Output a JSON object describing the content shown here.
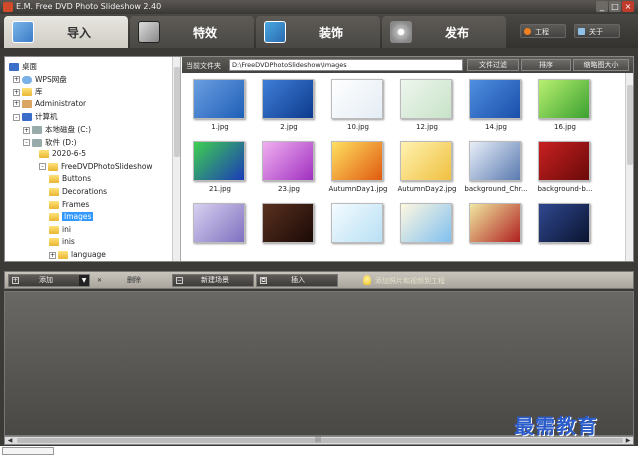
{
  "window": {
    "title": "E.M. Free DVD Photo Slideshow 2.40",
    "min": "_",
    "max": "□",
    "close": "×"
  },
  "tabs": [
    {
      "label": "导入",
      "active": true,
      "icon": "import-icon"
    },
    {
      "label": "特效",
      "active": false,
      "icon": "effects-icon"
    },
    {
      "label": "装饰",
      "active": false,
      "icon": "decorate-icon"
    },
    {
      "label": "发布",
      "active": false,
      "icon": "publish-icon"
    }
  ],
  "top_buttons": {
    "project": "工程",
    "about": "关于"
  },
  "tree": {
    "items": [
      {
        "label": "桌面",
        "icon": "monitor",
        "expander": ""
      },
      {
        "label": "WPS网盘",
        "icon": "cloud",
        "expander": "+"
      },
      {
        "label": "库",
        "icon": "folder",
        "expander": "+"
      },
      {
        "label": "Administrator",
        "icon": "user",
        "expander": "+"
      },
      {
        "label": "计算机",
        "icon": "monitor",
        "expander": "-"
      },
      {
        "label": "本地磁盘 (C:)",
        "icon": "drive",
        "expander": "+"
      },
      {
        "label": "软件 (D:)",
        "icon": "drive",
        "expander": "-"
      },
      {
        "label": "2020-6-5",
        "icon": "folder",
        "expander": ""
      },
      {
        "label": "FreeDVDPhotoSlideshow",
        "icon": "folder",
        "expander": "-"
      },
      {
        "label": "Buttons",
        "icon": "folder",
        "expander": ""
      },
      {
        "label": "Decorations",
        "icon": "folder",
        "expander": ""
      },
      {
        "label": "Frames",
        "icon": "folder",
        "expander": ""
      },
      {
        "label": "Images",
        "icon": "folder",
        "expander": "",
        "selected": true
      },
      {
        "label": "ini",
        "icon": "folder",
        "expander": ""
      },
      {
        "label": "inis",
        "icon": "folder",
        "expander": ""
      },
      {
        "label": "language",
        "icon": "folder",
        "expander": "+"
      }
    ]
  },
  "pathbar": {
    "label": "当前文件夹",
    "path": "D:\\FreeDVDPhotoSlideshow\\Images",
    "filter": "文件过滤",
    "sort": "排序",
    "thumb_size": "缩略图大小"
  },
  "thumbnails": [
    {
      "name": "1.jpg",
      "colors": [
        "#6a9ee0",
        "#1f5fb8"
      ]
    },
    {
      "name": "2.jpg",
      "colors": [
        "#3f7ed8",
        "#0d3b8c"
      ]
    },
    {
      "name": "10.jpg",
      "colors": [
        "#ffffff",
        "#e4ecf4"
      ]
    },
    {
      "name": "12.jpg",
      "colors": [
        "#eef6ee",
        "#c8e2c8"
      ]
    },
    {
      "name": "14.jpg",
      "colors": [
        "#4f8fe0",
        "#1a4faa"
      ]
    },
    {
      "name": "16.jpg",
      "colors": [
        "#b8f070",
        "#3aa030"
      ]
    },
    {
      "name": "21.jpg",
      "colors": [
        "#3fd050",
        "#1a3ab8"
      ]
    },
    {
      "name": "23.jpg",
      "colors": [
        "#f0b0f0",
        "#a030c0"
      ]
    },
    {
      "name": "AutumnDay1.jpg",
      "colors": [
        "#ffe060",
        "#e05a10"
      ]
    },
    {
      "name": "AutumnDay2.jpg",
      "colors": [
        "#fff2b0",
        "#f0c040"
      ]
    },
    {
      "name": "background_Chr...",
      "colors": [
        "#e8eef8",
        "#5a7ab0"
      ]
    },
    {
      "name": "background-b...",
      "colors": [
        "#c82020",
        "#6a0a0a"
      ]
    },
    {
      "name": "",
      "colors": [
        "#d8d0f0",
        "#8070c0"
      ]
    },
    {
      "name": "",
      "colors": [
        "#5a3020",
        "#1a0a05"
      ]
    },
    {
      "name": "",
      "colors": [
        "#f4fbff",
        "#b8e0f4"
      ]
    },
    {
      "name": "",
      "colors": [
        "#fff8e0",
        "#80c0f0"
      ]
    },
    {
      "name": "",
      "colors": [
        "#f0e8a0",
        "#b02020"
      ]
    },
    {
      "name": "",
      "colors": [
        "#304890",
        "#0a1430"
      ]
    }
  ],
  "actionbar": {
    "add": "添加",
    "delete": "删除",
    "new_scene": "新建场景",
    "insert": "插入",
    "hint": "添加照片和视频到工程"
  },
  "watermark": "最需教育"
}
